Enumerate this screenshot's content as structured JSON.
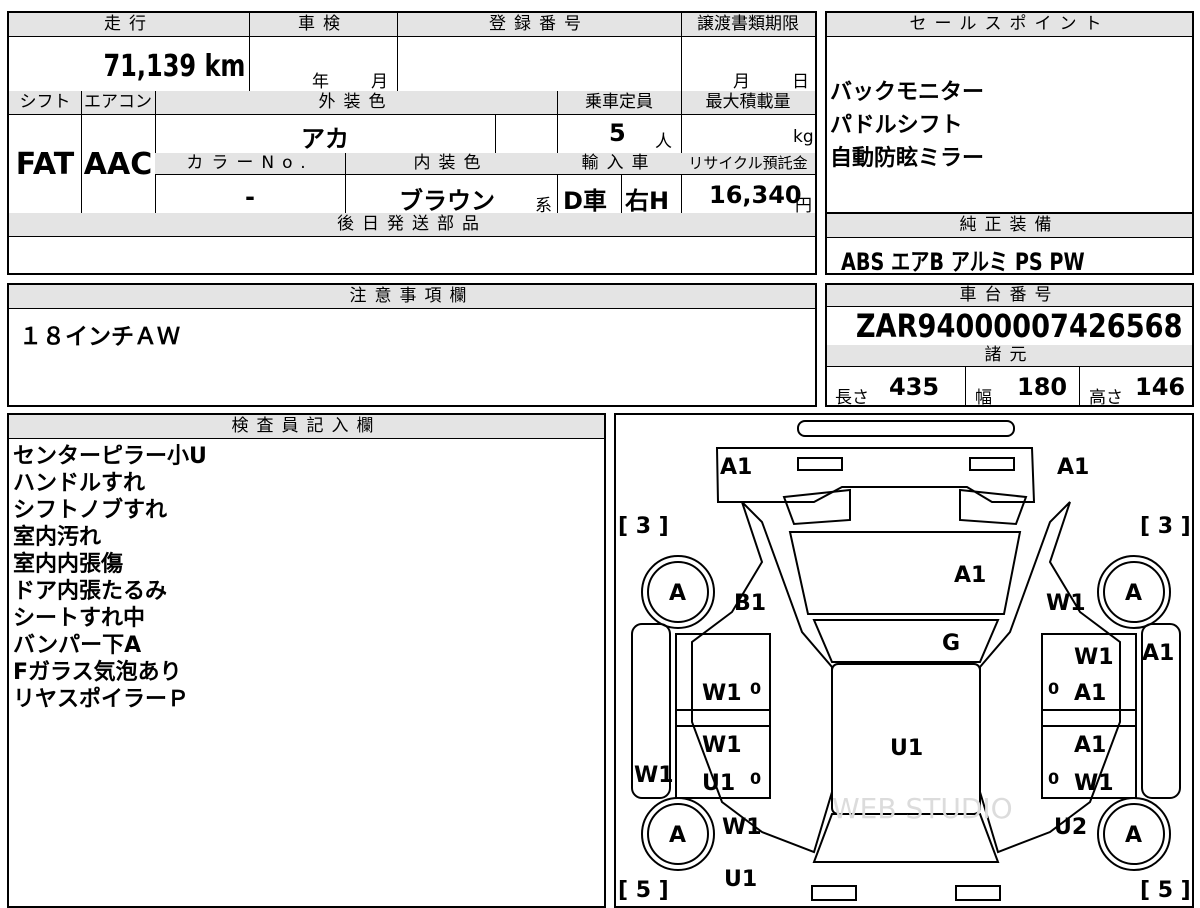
{
  "headers": {
    "mileage": "走行",
    "inspection": "車検",
    "registration_no": "登録番号",
    "transfer_deadline": "譲渡書類期限",
    "shift": "シフト",
    "aircon": "エアコン",
    "exterior_color": "外装色",
    "capacity": "乗車定員",
    "max_load": "最大積載量",
    "color_no": "カラーNo.",
    "interior_color": "内装色",
    "import": "輸入車",
    "recycle": "リサイクル預託金",
    "later_parts": "後日発送部品",
    "sales_points": "セールスポイント",
    "equipment": "純正装備",
    "notes": "注意事項欄",
    "chassis": "車台番号",
    "specs": "諸元",
    "inspector": "検査員記入欄"
  },
  "vehicle": {
    "mileage": "71,139 km",
    "inspection_year_unit": "年",
    "inspection_month_unit": "月",
    "deadline_month_unit": "月",
    "deadline_day_unit": "日",
    "shift": "FAT",
    "aircon": "AAC",
    "exterior_color": "アカ",
    "capacity": "5",
    "capacity_unit": "人",
    "load_unit": "kg",
    "color_no": "-",
    "interior_color": "ブラウン",
    "interior_suffix": "系",
    "import_type": "D車",
    "steering": "右H",
    "recycle_fee": "16,340",
    "recycle_unit": "円"
  },
  "sales_points": [
    "バックモニター",
    "パドルシフト",
    "自動防眩ミラー"
  ],
  "equipment": "ABS エアB アルミ PS PW",
  "notes": "１８インチＡＷ",
  "chassis_number": "ZAR94000007426568",
  "dimensions": {
    "length_label": "長さ",
    "length": "435",
    "width_label": "幅",
    "width": "180",
    "height_label": "高さ",
    "height": "146"
  },
  "inspector_notes": [
    "センターピラー小U",
    "ハンドルすれ",
    "シフトノブすれ",
    "室内汚れ",
    "室内内張傷",
    "ドア内張たるみ",
    "シートすれ中",
    "バンパー下A",
    "Fガラス気泡あり",
    "リヤスポイラーＰ"
  ],
  "diagram": {
    "tire_left_front": "[ 3 ]",
    "tire_right_front": "[ 3 ]",
    "tire_left_rear": "[ 5 ]",
    "tire_right_rear": "[ 5 ]",
    "wheel_grade": "A",
    "marks": {
      "front_left": "A1",
      "front_right": "A1",
      "bonnet": "A1",
      "fender_left": "B1",
      "fender_right": "W1",
      "windshield": "G",
      "right_pillar": "A1",
      "front_door_left": "W1",
      "front_door_right_top": "W1",
      "front_door_right": "A1",
      "roof": "U1",
      "rear_door_left_top": "W1",
      "rear_door_left": "U1",
      "sill_left": "W1",
      "rear_door_right_top": "A1",
      "rear_door_right": "W1",
      "quarter_left": "W1",
      "quarter_right": "U2",
      "rear": "U1",
      "zero": "0"
    },
    "watermark": "WEB STUDIO"
  }
}
